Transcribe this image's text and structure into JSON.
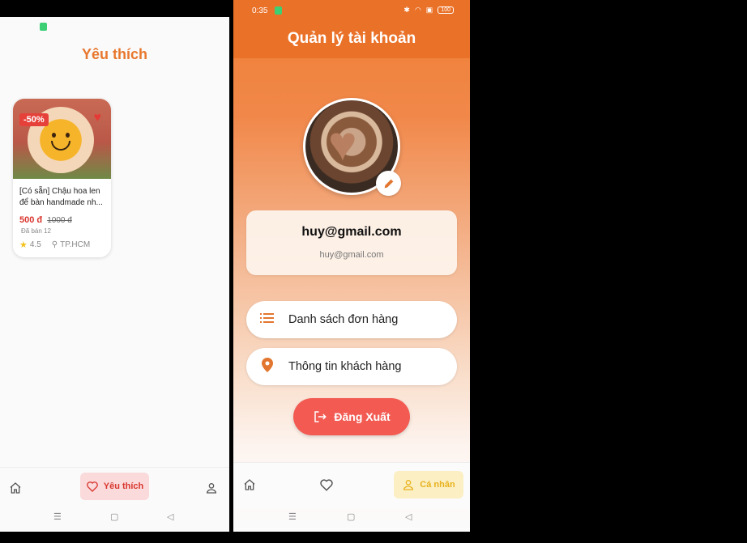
{
  "left": {
    "title": "Yêu thích",
    "product": {
      "discount": "-50%",
      "name": "[Có sẵn] Chậu hoa len để bàn handmade nh...",
      "price": "500 đ",
      "old_price": "1000 đ",
      "sold": "Đã bán 12",
      "rating": "4.5",
      "location": "TP.HCM"
    },
    "nav": {
      "home_icon": "home-icon",
      "favorites_label": "Yêu thích",
      "profile_icon": "person-icon"
    }
  },
  "right": {
    "status": {
      "time": "0:35",
      "battery": "100"
    },
    "title": "Quản lý tài khoản",
    "email_main": "huy@gmail.com",
    "email_sub": "huy@gmail.com",
    "menu": [
      {
        "label": "Danh sách đơn hàng",
        "icon": "list-icon"
      },
      {
        "label": "Thông tin khách hàng",
        "icon": "location-pin-icon"
      }
    ],
    "logout_label": "Đăng Xuất",
    "nav": {
      "home_icon": "home-icon",
      "favorites_icon": "heart-icon",
      "profile_label": "Cá nhân"
    }
  },
  "colors": {
    "accent": "#e8772e",
    "logout": "#f25a52",
    "price": "#d9362e",
    "active_fav_bg": "#fadadb",
    "active_profile_bg": "#fbefc3"
  }
}
